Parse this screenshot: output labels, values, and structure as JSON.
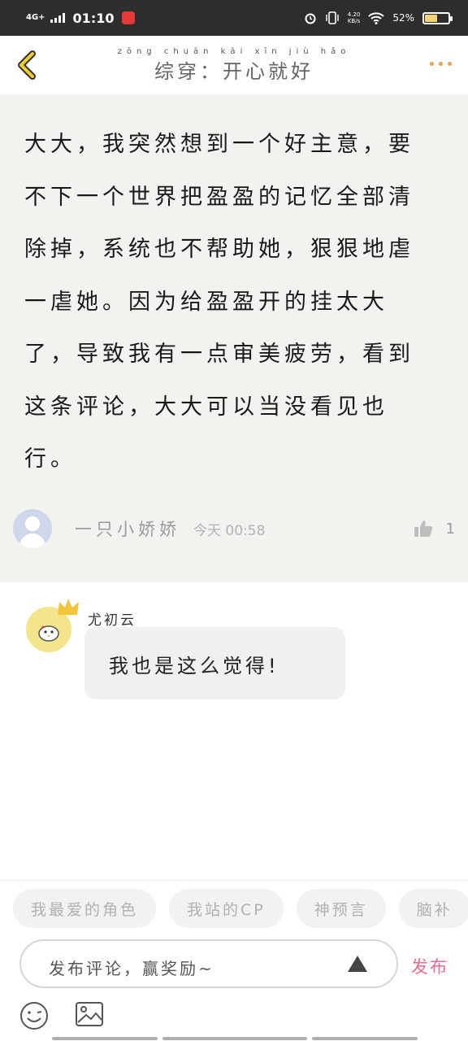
{
  "status_bar": {
    "network": "4G+",
    "time": "01:10",
    "speed_value": "4.20",
    "speed_unit": "KB/s",
    "battery": "52%",
    "battery_level": 0.52
  },
  "header": {
    "title": "综穿：开心就好",
    "title_pinyin": "zōng chuān kāi xīn jiù hǎo"
  },
  "story": {
    "lines": [
      "大大，我突然想到一个好主意，要",
      "不下一个世界把盈盈的记忆全部清",
      "除掉，系统也不帮助她，狠狠地虐",
      "一虐她。因为给盈盈开的挂太大",
      "了，导致我有一点审美疲劳，看到",
      "这条评论，大大可以当没看见也",
      "行。"
    ],
    "author": "一只小娇娇",
    "time_label": "今天",
    "time": "00:58",
    "likes": "1"
  },
  "comment": {
    "username": "尤初云",
    "text": "我也是这么觉得!"
  },
  "bottom": {
    "tags": [
      "我最爱的角色",
      "我站的CP",
      "神预言",
      "脑补"
    ],
    "input_placeholder": "发布评论，赢奖励~",
    "publish_label": "发布"
  },
  "colors": {
    "accent_orange": "#f0a050",
    "publish_pink": "#ee6a8c",
    "content_bg": "#f2f2ee",
    "back_yellow": "#f4cc2e"
  },
  "icons": [
    "back-arrow-icon",
    "more-dots-icon",
    "thumb-up-icon",
    "crown-icon",
    "up-arrow-icon",
    "smile-icon",
    "image-icon"
  ]
}
